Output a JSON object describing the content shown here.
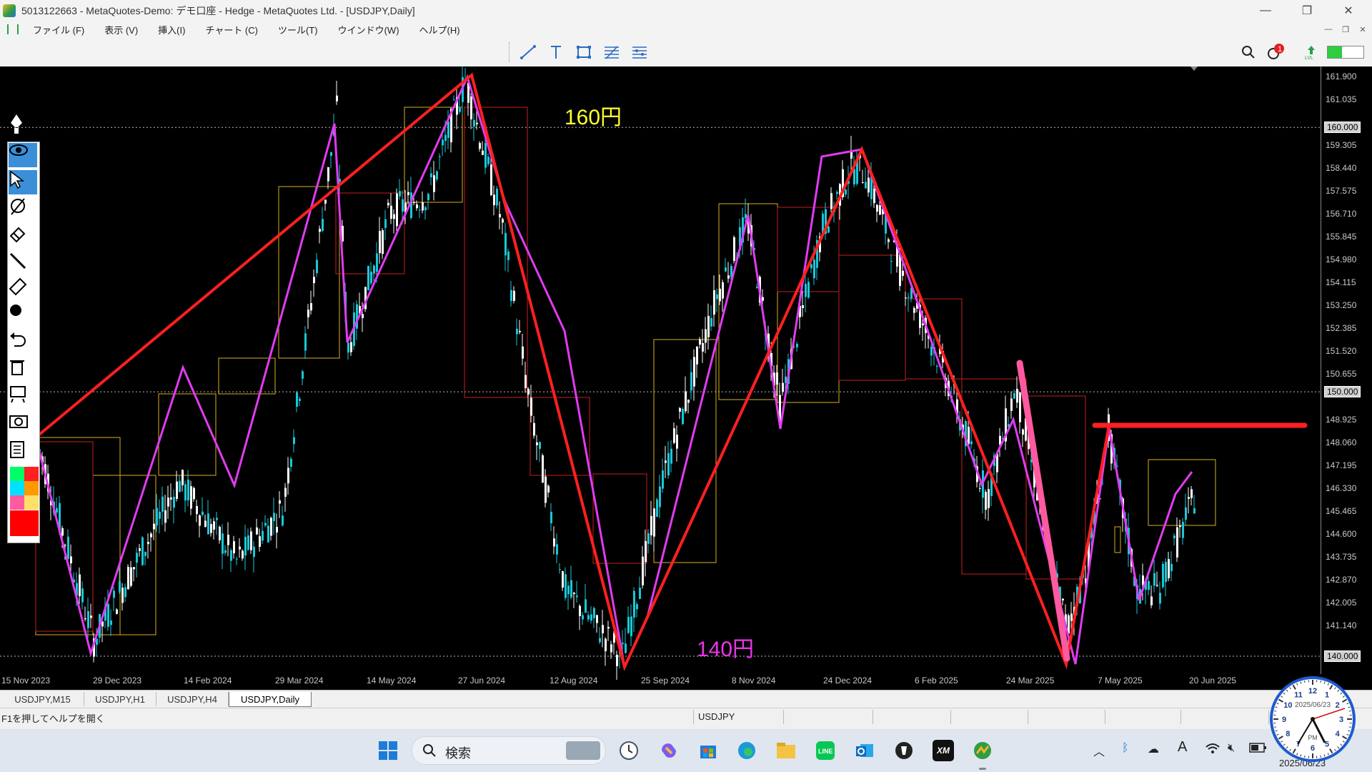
{
  "window": {
    "title": "5013122663 - MetaQuotes-Demo: デモ口座 - Hedge - MetaQuotes Ltd. - [USDJPY,Daily]",
    "controls": {
      "minimize": "—",
      "maximize": "❐",
      "close": "✕"
    }
  },
  "menu": {
    "items": [
      "ファイル (F)",
      "表示 (V)",
      "挿入(I)",
      "チャート (C)",
      "ツール(T)",
      "ウインドウ(W)",
      "ヘルプ(H)"
    ]
  },
  "toolbar": {
    "tools": [
      "trendline-icon",
      "text-icon",
      "rectangle-icon",
      "fibonacci-icon",
      "channel-icon"
    ],
    "notification_count": "1",
    "right_icons": [
      "search-icon",
      "notification-icon",
      "signal-icon",
      "battery-icon"
    ]
  },
  "chart": {
    "symbol": "USDJPY",
    "timeframe": "Daily",
    "annotations": {
      "upper": "160円",
      "lower": "140円"
    },
    "price_labels": [
      "161.900",
      "161.035",
      "160.000",
      "159.305",
      "158.440",
      "157.575",
      "156.710",
      "155.845",
      "154.980",
      "154.115",
      "153.250",
      "152.385",
      "151.520",
      "150.655",
      "150.000",
      "148.925",
      "148.060",
      "147.195",
      "146.330",
      "145.465",
      "144.600",
      "143.735",
      "142.870",
      "142.005",
      "141.140",
      "140.000"
    ],
    "highlight_prices": [
      "160.000",
      "150.000",
      "140.000"
    ],
    "date_labels": [
      "15 Nov 2023",
      "29 Dec 2023",
      "14 Feb 2024",
      "29 Mar 2024",
      "14 May 2024",
      "27 Jun 2024",
      "12 Aug 2024",
      "25 Sep 2024",
      "8 Nov 2024",
      "24 Dec 2024",
      "6 Feb 2025",
      "24 Mar 2025",
      "7 May 2025",
      "20 Jun 2025"
    ],
    "colors": {
      "background": "#000000",
      "bull": "#19c8d8",
      "bear": "#ffffff",
      "zigzag_minor": "#e03cf0",
      "zigzag_major": "#ff2020",
      "highlight": "#ff5aa0",
      "box_gold": "#d8b020",
      "box_red": "#c81e1e"
    }
  },
  "left_tools": [
    "pen-icon",
    "eye-icon",
    "cursor-icon",
    "lasso-icon",
    "eraser-pencil-icon",
    "line-icon",
    "ruler-icon",
    "dot-icon",
    "undo-icon",
    "trash-icon",
    "screen-icon",
    "camera-icon",
    "clipboard-icon"
  ],
  "palette": [
    "#00ff66",
    "#ff2020",
    "#00e0ff",
    "#ff9900",
    "#ff5aa0",
    "#ffe066",
    "#ff0000"
  ],
  "tabs": [
    "USDJPY,M15",
    "USDJPY,H1",
    "USDJPY,H4",
    "USDJPY,Daily"
  ],
  "active_tab": "USDJPY,Daily",
  "status": {
    "help": "F1を押してヘルプを開く",
    "symbol": "USDJPY"
  },
  "taskbar": {
    "search_placeholder": "検索",
    "apps": [
      "windows-start-icon",
      "search-icon",
      "clock-app-icon",
      "copilot-icon",
      "store-icon",
      "edge-icon",
      "explorer-icon",
      "line-app-icon",
      "outlook-icon",
      "terminal-icon",
      "xm-icon",
      "mt5-icon"
    ],
    "tray": [
      "chevron-up-icon",
      "bluetooth-icon",
      "cloud-icon",
      "font-icon",
      "wifi-icon",
      "mute-icon",
      "battery-icon"
    ],
    "date": "2025/06/23"
  },
  "desktop_clock": {
    "date": "2025/06/23",
    "period": "PM",
    "numerals": [
      "12",
      "1",
      "2",
      "3",
      "4",
      "5",
      "6",
      "7",
      "8",
      "9",
      "10",
      "11"
    ]
  }
}
